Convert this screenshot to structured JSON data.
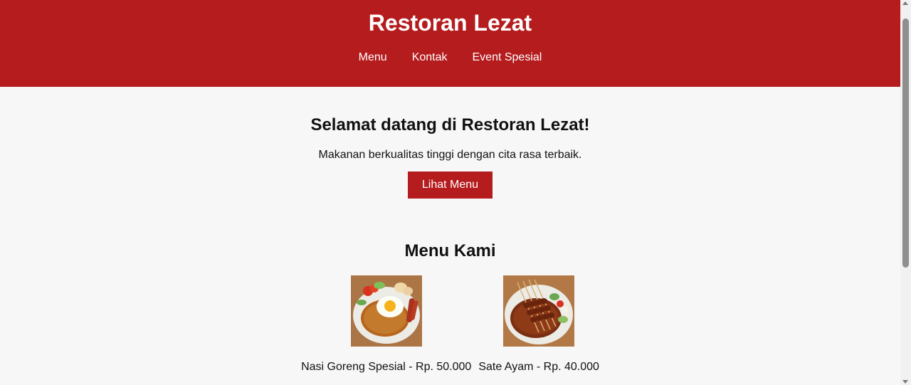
{
  "header": {
    "title": "Restoran Lezat",
    "nav": [
      "Menu",
      "Kontak",
      "Event Spesial"
    ]
  },
  "hero": {
    "heading": "Selamat datang di Restoran Lezat!",
    "tagline": "Makanan berkualitas tinggi dengan cita rasa terbaik.",
    "button_label": "Lihat Menu"
  },
  "menu": {
    "heading": "Menu Kami",
    "items": [
      {
        "label": "Nasi Goreng Spesial - Rp. 50.000",
        "image": "nasi-goreng-photo"
      },
      {
        "label": "Sate Ayam - Rp. 40.000",
        "image": "sate-ayam-photo"
      }
    ]
  },
  "colors": {
    "brand": "#b51c1e",
    "background": "#f7f7f7"
  }
}
